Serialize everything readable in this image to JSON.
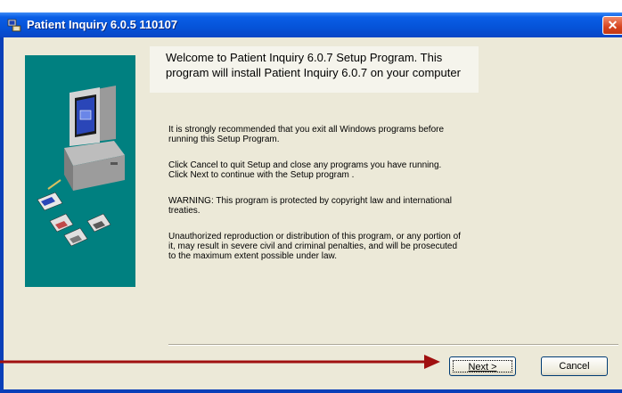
{
  "window": {
    "title": "Patient Inquiry 6.0.5 110107",
    "close_glyph": "✕",
    "title_icon": "setup-app-icon"
  },
  "welcome": {
    "heading": "Welcome to Patient Inquiry 6.0.7 Setup Program. This program will install Patient Inquiry 6.0.7 on your computer"
  },
  "body": {
    "para1": "It is strongly recommended that you exit all Windows programs before running this Setup Program.",
    "para2": "Click Cancel to quit Setup and close any programs you have running.  Click Next to continue with the Setup program .",
    "para3": "WARNING: This program is protected by copyright law and international treaties.",
    "para4": "Unauthorized reproduction or distribution of this program, or any portion of it, may result in severe civil and criminal penalties, and will be prosecuted to the maximum extent possible under law."
  },
  "buttons": {
    "next_label": "Next >",
    "next_accelerator": "N",
    "cancel_label": "Cancel"
  },
  "annotation": {
    "arrow_color": "#a01010",
    "target": "next-button"
  },
  "colors": {
    "titlebar": "#0553d8",
    "client": "#ece9d8",
    "art_background": "#008080"
  }
}
